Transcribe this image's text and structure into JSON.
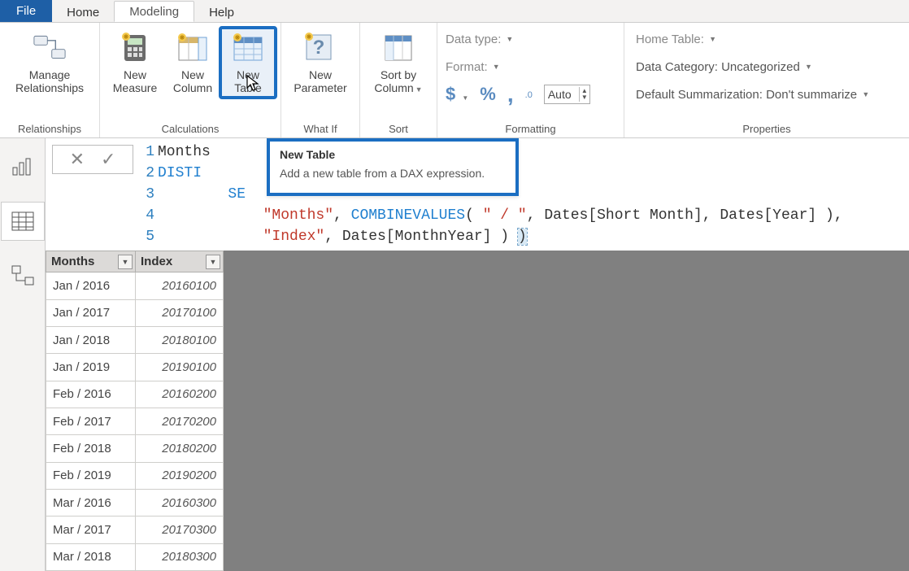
{
  "tabs": {
    "file": "File",
    "home": "Home",
    "modeling": "Modeling",
    "help": "Help",
    "active": "modeling"
  },
  "ribbon": {
    "relationships": {
      "manage": {
        "line1": "Manage",
        "line2": "Relationships"
      },
      "group_label": "Relationships"
    },
    "calculations": {
      "measure": {
        "line1": "New",
        "line2": "Measure"
      },
      "column": {
        "line1": "New",
        "line2": "Column"
      },
      "table": {
        "line1": "New",
        "line2": "Table"
      },
      "group_label": "Calculations"
    },
    "whatif": {
      "parameter": {
        "line1": "New",
        "line2": "Parameter"
      },
      "group_label": "What If"
    },
    "sort": {
      "sortby": {
        "line1": "Sort by",
        "line2": "Column"
      },
      "group_label": "Sort"
    },
    "formatting": {
      "datatype_label": "Data type:",
      "format_label": "Format:",
      "currency": "$",
      "percent": "%",
      "comma": ",",
      "decimals_icon": ".00",
      "decimals_value": "Auto",
      "group_label": "Formatting"
    },
    "properties": {
      "home_table": "Home Table:",
      "category_label": "Data Category:",
      "category_value": "Uncategorized",
      "summarization_label": "Default Summarization:",
      "summarization_value": "Don't summarize",
      "group_label": "Properties"
    }
  },
  "tooltip": {
    "title": "New Table",
    "body": "Add a new table from a DAX expression."
  },
  "formula": {
    "lines": [
      "1",
      "2",
      "3",
      "4",
      "5"
    ],
    "l1_a": "Months",
    "l2_kw": "DISTI",
    "l3_indent": "        ",
    "l3_kw": "SE",
    "l4_indent": "            ",
    "l4_str1": "\"Months\"",
    "l4_sep1": ", ",
    "l4_fn": "COMBINEVALUES",
    "l4_open": "( ",
    "l4_str2": "\" / \"",
    "l4_rest": ", Dates[Short Month], Dates[Year] ),",
    "l5_indent": "            ",
    "l5_str": "\"Index\"",
    "l5_rest": ", Dates[MonthnYear] ) ",
    "l5_close": ")"
  },
  "table": {
    "columns": {
      "months": "Months",
      "index": "Index"
    },
    "rows": [
      {
        "m": "Jan / 2016",
        "i": "20160100"
      },
      {
        "m": "Jan / 2017",
        "i": "20170100"
      },
      {
        "m": "Jan / 2018",
        "i": "20180100"
      },
      {
        "m": "Jan / 2019",
        "i": "20190100"
      },
      {
        "m": "Feb / 2016",
        "i": "20160200"
      },
      {
        "m": "Feb / 2017",
        "i": "20170200"
      },
      {
        "m": "Feb / 2018",
        "i": "20180200"
      },
      {
        "m": "Feb / 2019",
        "i": "20190200"
      },
      {
        "m": "Mar / 2016",
        "i": "20160300"
      },
      {
        "m": "Mar / 2017",
        "i": "20170300"
      },
      {
        "m": "Mar / 2018",
        "i": "20180300"
      }
    ]
  }
}
